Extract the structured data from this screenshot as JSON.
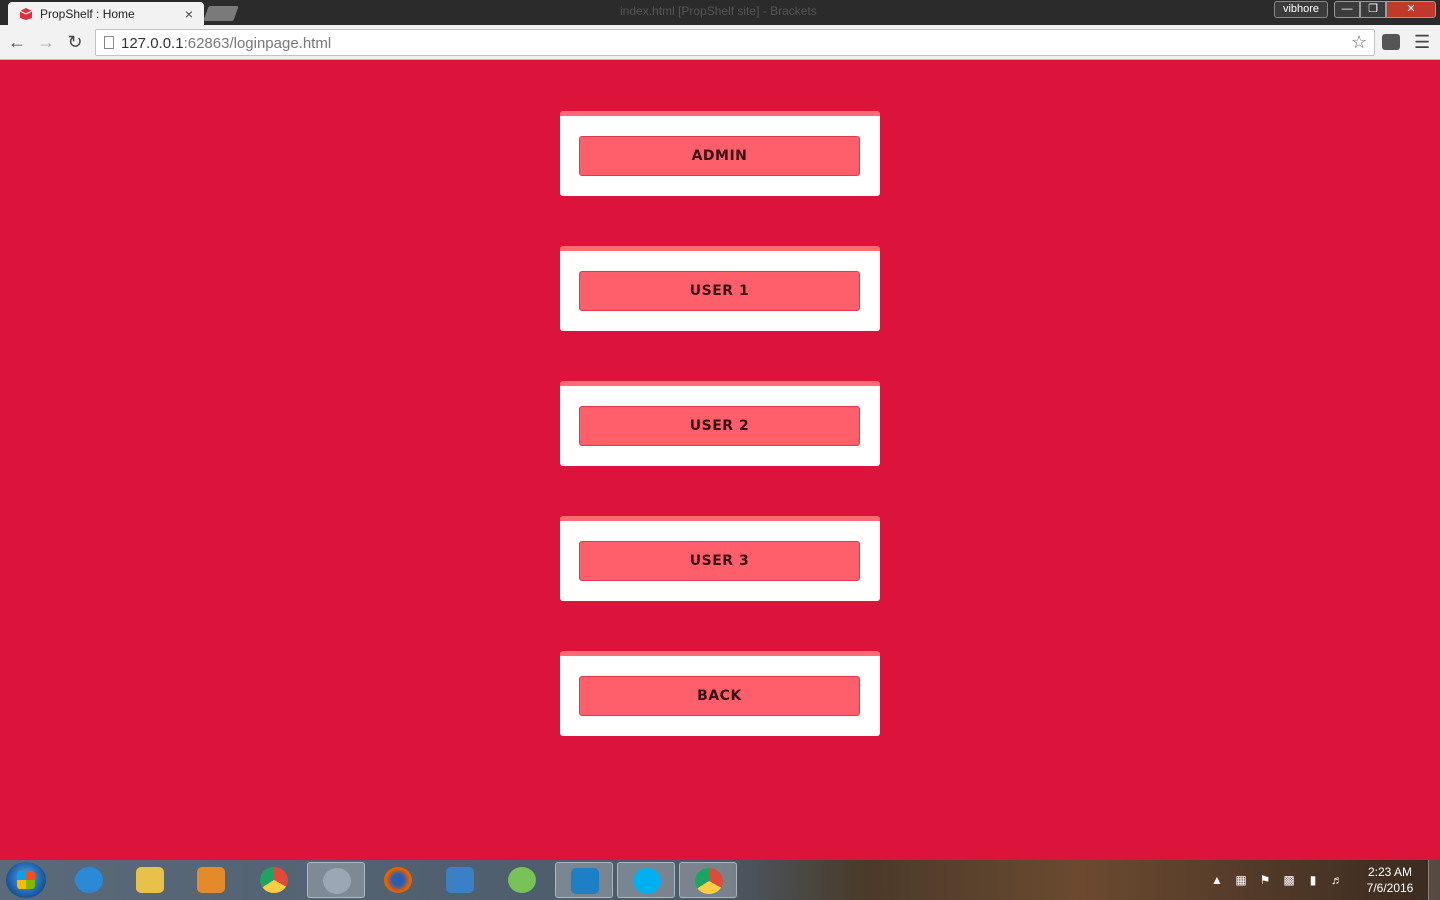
{
  "browser": {
    "tab_title": "PropShelf : Home",
    "tab_close": "×",
    "window_title": "index.html [PropShelf site] - Brackets",
    "user_name": "vibhore",
    "minimize": "—",
    "maximize": "❐",
    "close": "✕",
    "url_host": "127.0.0.1",
    "url_rest": ":62863/loginpage.html",
    "icons": {
      "back": "arrow-left-icon",
      "forward": "arrow-right-icon",
      "reload": "reload-icon",
      "bookmark": "star-icon",
      "menu": "hamburger-menu-icon"
    }
  },
  "page": {
    "buttons": [
      {
        "label": "ADMIN"
      },
      {
        "label": "USER 1"
      },
      {
        "label": "USER 2"
      },
      {
        "label": "USER 3"
      },
      {
        "label": "BACK"
      }
    ],
    "colors": {
      "background": "#dc143c",
      "card": "#ffffff",
      "button": "#ff5f6a"
    }
  },
  "taskbar": {
    "apps": [
      {
        "name": "internet-explorer",
        "color": "#2b8ad8"
      },
      {
        "name": "file-explorer",
        "color": "#e8c14a"
      },
      {
        "name": "media-player",
        "color": "#e58a2a"
      },
      {
        "name": "chrome",
        "color": "#dd4b39"
      },
      {
        "name": "paint",
        "color": "#9aa7b5"
      },
      {
        "name": "firefox",
        "color": "#e66000"
      },
      {
        "name": "control-panel",
        "color": "#3b7fc4"
      },
      {
        "name": "android-studio",
        "color": "#78c257"
      },
      {
        "name": "brackets",
        "color": "#1d7fc6"
      },
      {
        "name": "skype",
        "color": "#00aff0"
      },
      {
        "name": "chrome-profile",
        "color": "#dd4b39"
      }
    ],
    "time": "2:23 AM",
    "date": "7/6/2016"
  }
}
